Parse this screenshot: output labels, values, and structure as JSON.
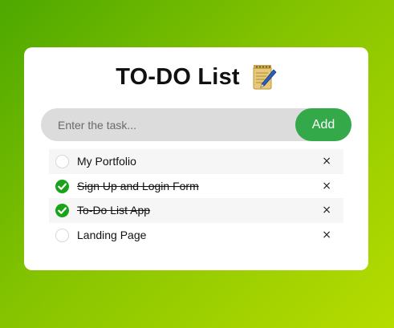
{
  "app": {
    "title": "TO-DO List",
    "title_icon": "memo-icon"
  },
  "input": {
    "placeholder": "Enter the task...",
    "value": "",
    "add_label": "Add",
    "add_color": "#34a94a"
  },
  "tasks": [
    {
      "label": "My Portfolio",
      "checked": false,
      "delete_label": "×"
    },
    {
      "label": "Sign Up and Login Form",
      "checked": true,
      "delete_label": "×"
    },
    {
      "label": "To-Do List App",
      "checked": true,
      "delete_label": "×"
    },
    {
      "label": "Landing Page",
      "checked": false,
      "delete_label": "×"
    }
  ],
  "colors": {
    "background_start": "#4da800",
    "background_end": "#b6dc00",
    "check": "#1aa31a"
  }
}
